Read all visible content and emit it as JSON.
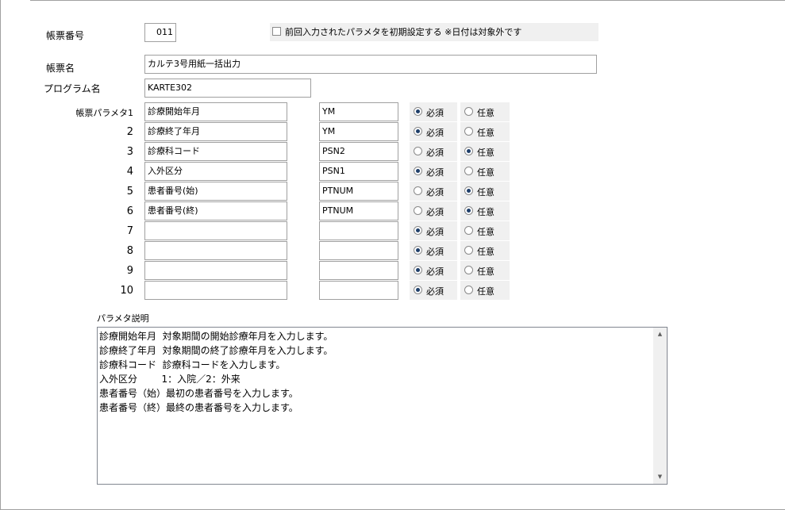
{
  "form": {
    "report_number_label": "帳票番号",
    "report_number_value": "011",
    "report_name_label": "帳票名",
    "report_name_value": "カルテ3号用紙一括出力",
    "program_name_label": "プログラム名",
    "program_name_value": "KARTE302",
    "init_checkbox_label": "前回入力されたパラメタを初期設定する  ※日付は対象外です",
    "init_checkbox_checked": false,
    "param_header_label": "帳票パラメタ1",
    "required_label": "必須",
    "optional_label": "任意",
    "params": [
      {
        "num": "帳票パラメタ1",
        "name": "診療開始年月",
        "code": "YM",
        "required": true
      },
      {
        "num": "2",
        "name": "診療終了年月",
        "code": "YM",
        "required": true
      },
      {
        "num": "3",
        "name": "診療科コード",
        "code": "PSN2",
        "required": false
      },
      {
        "num": "4",
        "name": "入外区分",
        "code": "PSN1",
        "required": true
      },
      {
        "num": "5",
        "name": "患者番号(始)",
        "code": "PTNUM",
        "required": false
      },
      {
        "num": "6",
        "name": "患者番号(終)",
        "code": "PTNUM",
        "required": false
      },
      {
        "num": "7",
        "name": "",
        "code": "",
        "required": true
      },
      {
        "num": "8",
        "name": "",
        "code": "",
        "required": true
      },
      {
        "num": "9",
        "name": "",
        "code": "",
        "required": true
      },
      {
        "num": "10",
        "name": "",
        "code": "",
        "required": true
      }
    ],
    "description_label": "パラメタ説明",
    "description_lines": [
      "診療開始年月  対象期間の開始診療年月を入力します。",
      "診療終了年月  対象期間の終了診療年月を入力します。",
      "診療科コード  診療科コードを入力します。",
      "入外区分        1：入院／2：外来",
      "患者番号（始）最初の患者番号を入力します。",
      "患者番号（終）最終の患者番号を入力します。"
    ]
  }
}
